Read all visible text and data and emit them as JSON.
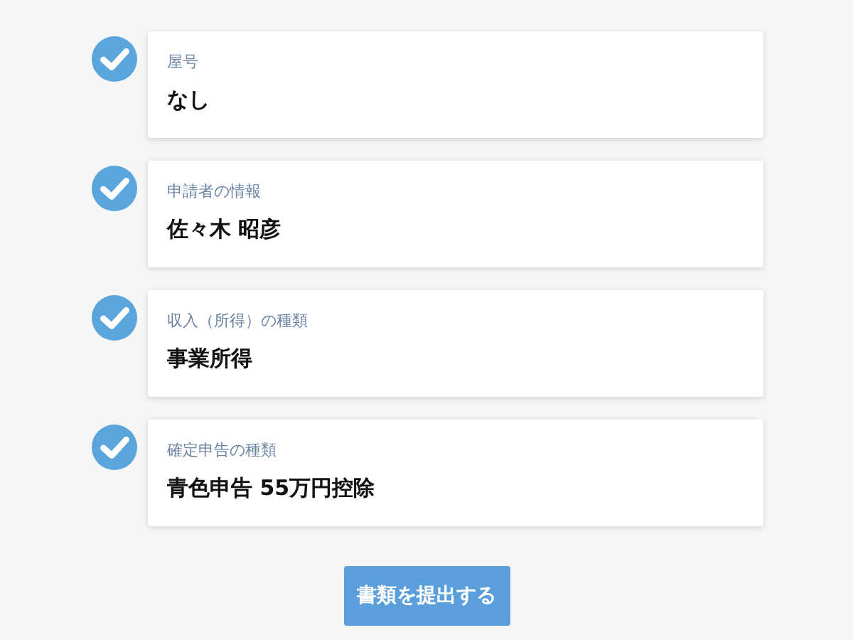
{
  "items": [
    {
      "label": "屋号",
      "value": "なし",
      "checked": true
    },
    {
      "label": "申請者の情報",
      "value": "佐々木 昭彦",
      "checked": true
    },
    {
      "label": "収入（所得）の種類",
      "value": "事業所得",
      "checked": true
    },
    {
      "label": "確定申告の種類",
      "value": "青色申告 55万円控除",
      "checked": true
    }
  ],
  "submit_button": "書類を提出する"
}
